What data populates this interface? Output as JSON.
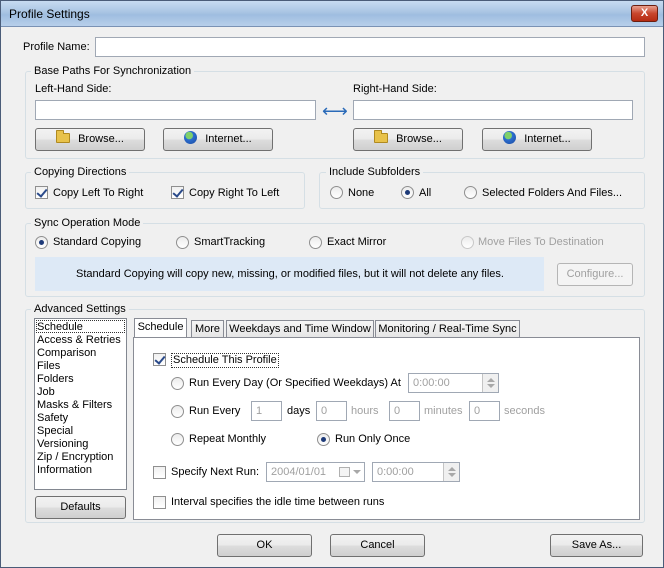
{
  "window": {
    "title": "Profile Settings",
    "close_glyph": "X"
  },
  "profile": {
    "name_label": "Profile Name:",
    "name_value": ""
  },
  "base_paths": {
    "title": "Base Paths For Synchronization",
    "left_label": "Left-Hand Side:",
    "right_label": "Right-Hand Side:",
    "left_value": "",
    "right_value": "",
    "arrow_glyph": "⟷",
    "browse_label": "Browse...",
    "internet_label": "Internet..."
  },
  "copying": {
    "title": "Copying Directions",
    "left_to_right": "Copy Left To Right",
    "right_to_left": "Copy Right To Left",
    "left_checked": true,
    "right_checked": true
  },
  "subfolders": {
    "title": "Include Subfolders",
    "none": "None",
    "all": "All",
    "selected": "Selected Folders And Files...",
    "value": "All"
  },
  "sync_mode": {
    "title": "Sync Operation Mode",
    "standard": "Standard Copying",
    "smart": "SmartTracking",
    "mirror": "Exact Mirror",
    "move": "Move Files To Destination",
    "value": "Standard Copying",
    "description": "Standard Copying will copy new, missing, or modified files, but it will not delete any files.",
    "configure_label": "Configure..."
  },
  "advanced": {
    "title": "Advanced Settings",
    "items": [
      "Schedule",
      "Access & Retries",
      "Comparison",
      "Files",
      "Folders",
      "Job",
      "Masks & Filters",
      "Safety",
      "Special",
      "Versioning",
      "Zip / Encryption",
      "Information"
    ],
    "selected": "Schedule",
    "defaults_label": "Defaults"
  },
  "tabs": [
    "Schedule",
    "More",
    "Weekdays and Time Window",
    "Monitoring / Real-Time Sync"
  ],
  "schedule": {
    "schedule_this": "Schedule This Profile",
    "schedule_checked": true,
    "every_day": "Run Every Day (Or Specified Weekdays) At",
    "every_day_time": "0:00:00",
    "run_every": "Run Every",
    "days_value": "1",
    "days_label": "days",
    "hours_value": "0",
    "hours_label": "hours",
    "minutes_value": "0",
    "minutes_label": "minutes",
    "seconds_value": "0",
    "seconds_label": "seconds",
    "monthly": "Repeat Monthly",
    "only_once": "Run Only Once",
    "mode": "Run Only Once",
    "next_run": "Specify Next Run:",
    "next_run_date": "2004/01/01",
    "next_run_time": "0:00:00",
    "interval_idle": "Interval specifies the idle time between runs"
  },
  "footer": {
    "ok": "OK",
    "cancel": "Cancel",
    "save_as": "Save As..."
  }
}
